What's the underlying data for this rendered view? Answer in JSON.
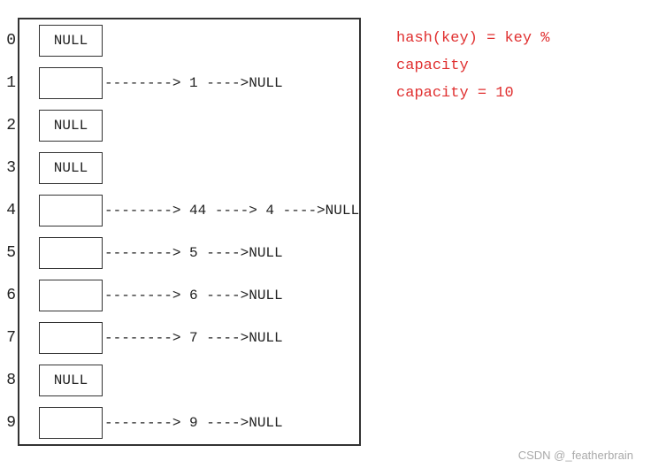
{
  "rows": [
    {
      "index": "0",
      "bucket": "NULL",
      "chain": ""
    },
    {
      "index": "1",
      "bucket": "",
      "chain": "--------> 1 ---->NULL"
    },
    {
      "index": "2",
      "bucket": "NULL",
      "chain": ""
    },
    {
      "index": "3",
      "bucket": "NULL",
      "chain": ""
    },
    {
      "index": "4",
      "bucket": "",
      "chain": "--------> 44 ----> 4  ---->NULL"
    },
    {
      "index": "5",
      "bucket": "",
      "chain": "--------> 5  ---->NULL"
    },
    {
      "index": "6",
      "bucket": "",
      "chain": "--------> 6  ---->NULL"
    },
    {
      "index": "7",
      "bucket": "",
      "chain": "--------> 7  ---->NULL"
    },
    {
      "index": "8",
      "bucket": "NULL",
      "chain": ""
    },
    {
      "index": "9",
      "bucket": "",
      "chain": "--------> 9  ---->NULL"
    }
  ],
  "formula": {
    "line1": "hash(key) = key %",
    "line2": "capacity",
    "line3": "capacity = 10"
  },
  "watermark": "CSDN @_featherbrain"
}
